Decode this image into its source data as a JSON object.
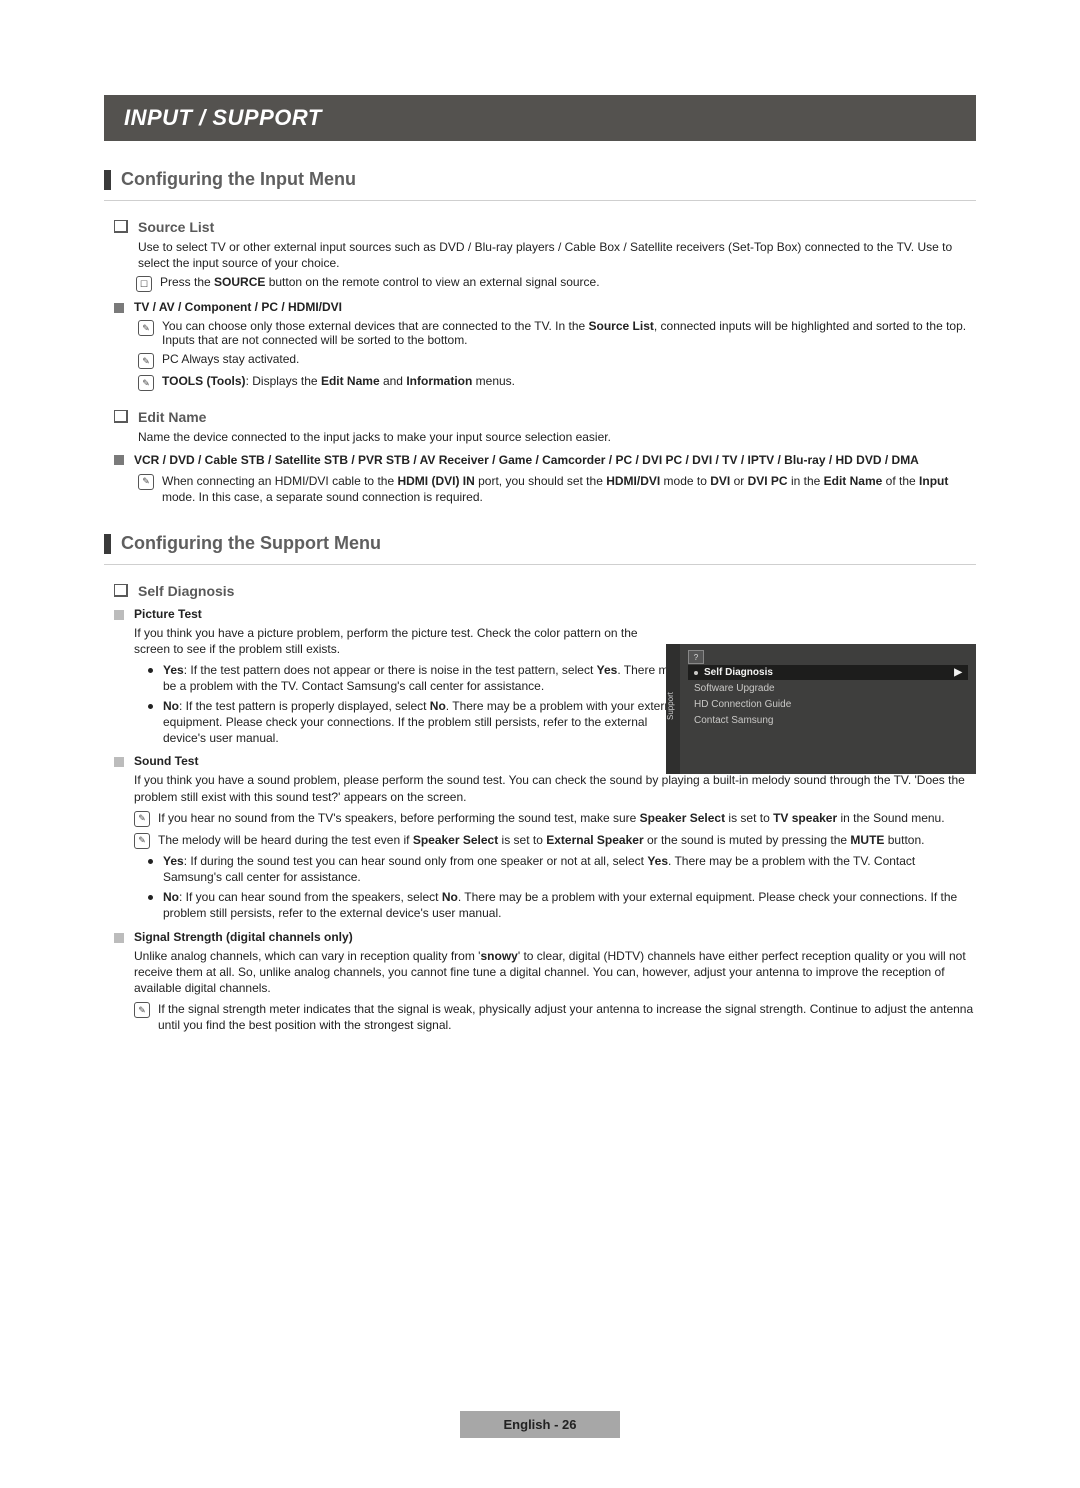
{
  "band": "INPUT / SUPPORT",
  "section1": {
    "title": "Configuring the Input Menu",
    "source_list": {
      "heading": "Source List",
      "desc": "Use to select TV or other external input sources such as DVD / Blu-ray players / Cable Box / Satellite receivers (Set-Top Box) connected to the TV. Use to select the input source of your choice.",
      "sourceBtn_pre": "Press the ",
      "sourceBtn_bold": "SOURCE",
      "sourceBtn_post": " button on the remote control to view an external signal source.",
      "sub_heading": "TV / AV / Component / PC / HDMI/DVI",
      "note1_a": "You can choose only those external devices that are connected to the TV. In the ",
      "note1_b": "Source List",
      "note1_c": ", connected inputs will be highlighted and sorted to the top. Inputs that are not connected will be sorted to the bottom.",
      "note2": "PC Always stay activated.",
      "note3_a": "TOOLS (Tools)",
      "note3_b": ": Displays the ",
      "note3_c": "Edit Name",
      "note3_d": " and ",
      "note3_e": "Information",
      "note3_f": " menus."
    },
    "edit_name": {
      "heading": "Edit Name",
      "desc": "Name the device connected to the input jacks to make your input source selection easier.",
      "list": "VCR / DVD / Cable STB / Satellite STB / PVR STB / AV Receiver / Game / Camcorder / PC / DVI PC / DVI / TV / IPTV / Blu-ray / HD DVD / DMA",
      "note_a": "When connecting an HDMI/DVI cable to the ",
      "note_b": "HDMI (DVI) IN",
      "note_c": " port, you should set the ",
      "note_d": "HDMI/DVI",
      "note_e": " mode to ",
      "note_f": "DVI",
      "note_g": " or ",
      "note_h": "DVI PC",
      "note_i": " in the ",
      "note_j": "Edit Name",
      "note_k": " of the ",
      "note_l": "Input",
      "note_m": " mode. In this case, a separate sound connection is required."
    }
  },
  "section2": {
    "title": "Configuring the Support Menu",
    "self_diag": {
      "heading": "Self Diagnosis",
      "picture": {
        "title": "Picture Test",
        "desc": "If you think you have a picture problem, perform the picture test. Check the color pattern on the screen to see if the problem still exists.",
        "yes_a": "Yes",
        "yes_b": ": If the test pattern does not appear or there is noise in the test pattern, select ",
        "yes_c": "Yes",
        "yes_d": ". There may be a problem with the TV. Contact Samsung's call center for assistance.",
        "no_a": "No",
        "no_b": ": If the test pattern is properly displayed, select ",
        "no_c": "No",
        "no_d": ". There may be a problem with your external equipment. Please check your connections. If the problem still persists, refer to the external device's user manual."
      },
      "sound": {
        "title": "Sound Test",
        "desc": "If you think you have a sound problem, please perform the sound test. You can check the sound by playing a built-in melody sound through the TV. 'Does the problem still exist with this sound test?' appears on the screen.",
        "n1_a": "If you hear no sound from the TV's speakers, before performing the sound test, make sure ",
        "n1_b": "Speaker Select",
        "n1_c": " is set to ",
        "n1_d": "TV speaker",
        "n1_e": " in the Sound menu.",
        "n2_a": "The melody will be heard during the test even if ",
        "n2_b": "Speaker Select",
        "n2_c": " is set to ",
        "n2_d": "External Speaker",
        "n2_e": " or the sound is muted by pressing the ",
        "n2_f": "MUTE",
        "n2_g": " button.",
        "yes_a": "Yes",
        "yes_b": ": If during the sound test you can hear sound only from one speaker or not at all, select ",
        "yes_c": "Yes",
        "yes_d": ". There may be a problem with the TV. Contact Samsung's call center for assistance.",
        "no_a": "No",
        "no_b": ": If you can hear sound from the speakers, select ",
        "no_c": "No",
        "no_d": ". There may be a problem with your external equipment. Please check your connections. If the problem still persists, refer to the external device's user manual."
      },
      "signal": {
        "title": "Signal Strength (digital channels only)",
        "desc_a": "Unlike analog channels, which can vary in reception quality from '",
        "desc_b": "snowy",
        "desc_c": "' to clear, digital (HDTV) channels have either perfect reception quality or you will not receive them at all. So, unlike analog channels, you cannot fine tune a digital channel. You can, however, adjust your antenna to improve the reception of available digital channels.",
        "note": "If the signal strength meter indicates that the signal is weak, physically adjust your antenna to increase the signal strength. Continue to adjust the antenna until you find the best position with the strongest signal."
      }
    }
  },
  "tv": {
    "side": "Support",
    "items": [
      "Self Diagnosis",
      "Software Upgrade",
      "HD Connection Guide",
      "Contact Samsung"
    ]
  },
  "footer": "English - 26"
}
